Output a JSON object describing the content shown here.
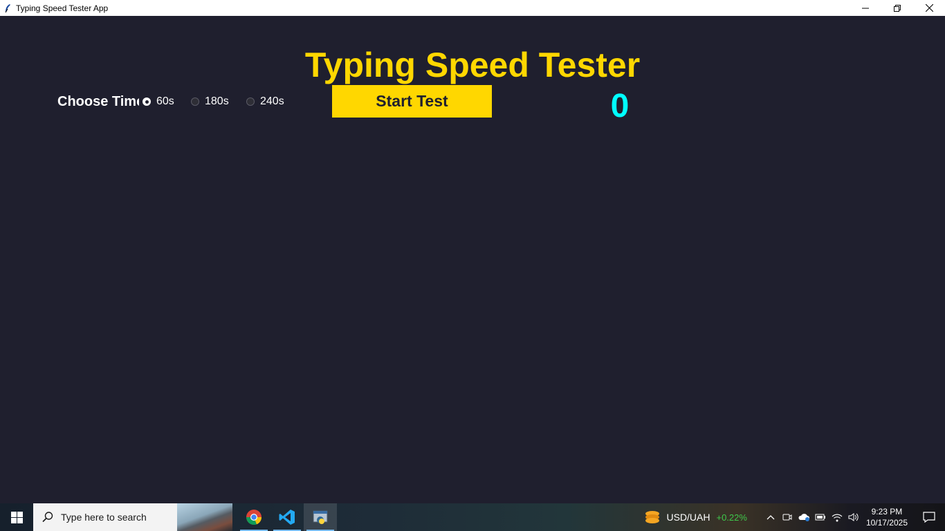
{
  "window": {
    "title": "Typing Speed Tester App",
    "controls": [
      "minimize",
      "restore",
      "close"
    ]
  },
  "app": {
    "heading": "Typing Speed Tester",
    "choose_time_label": "Choose Time",
    "time_options": [
      {
        "label": "60s",
        "selected": true
      },
      {
        "label": "180s",
        "selected": false
      },
      {
        "label": "240s",
        "selected": false
      }
    ],
    "start_button_label": "Start Test",
    "counter": "0",
    "colors": {
      "background": "#1f1f2e",
      "accent": "#ffd700",
      "counter": "#00ffff",
      "text": "#ffffff"
    }
  },
  "taskbar": {
    "search_placeholder": "Type here to search",
    "pinned_apps": [
      "chrome-icon",
      "vscode-icon",
      "python-tk-icon"
    ],
    "currency_pair": "USD/UAH",
    "currency_change": "+0.22%",
    "time": "9:23 PM",
    "date": "10/17/2025"
  }
}
